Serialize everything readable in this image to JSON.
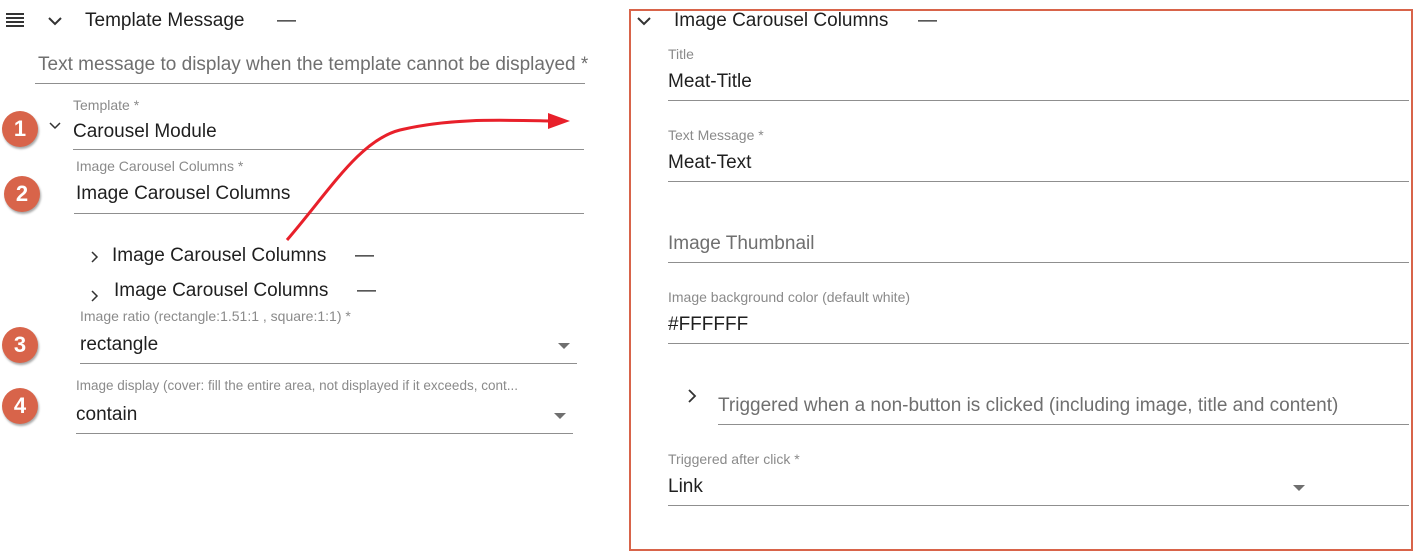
{
  "colors": {
    "badge": "#d8644a",
    "frame": "#d8644a",
    "arrow": "#e8202a"
  },
  "left": {
    "header": {
      "menu_icon": "hamburger-icon",
      "expand_icon": "chevron-down-icon",
      "title": "Template Message",
      "remove_icon": "dash-icon",
      "remove_glyph": "—"
    },
    "alt_text_field": {
      "placeholder": "Text message to display when the template cannot be displayed *"
    },
    "template_field": {
      "badge": "1",
      "label": "Template *",
      "value": "Carousel Module"
    },
    "columns_field": {
      "badge": "2",
      "label": "Image Carousel Columns *",
      "value": "Image Carousel Columns"
    },
    "column_items": [
      {
        "label": "Image Carousel Columns",
        "remove_glyph": "—"
      },
      {
        "label": "Image Carousel Columns",
        "remove_glyph": "—"
      }
    ],
    "ratio_field": {
      "badge": "3",
      "label": "Image ratio (rectangle:1.51:1 , square:1:1) *",
      "value": "rectangle"
    },
    "display_field": {
      "badge": "4",
      "label": "Image display (cover: fill the entire area, not displayed if it exceeds, cont...",
      "value": "contain"
    }
  },
  "right": {
    "header": {
      "title": "Image Carousel Columns",
      "remove_glyph": "—"
    },
    "title_field": {
      "label": "Title",
      "value": "Meat-Title"
    },
    "text_field": {
      "label": "Text Message *",
      "value": "Meat-Text"
    },
    "thumbnail_field": {
      "placeholder": "Image Thumbnail"
    },
    "bg_color_field": {
      "label": "Image background color (default white)",
      "value": "#FFFFFF"
    },
    "non_button_action": {
      "label": "Triggered when a non-button is clicked (including image, title and content)"
    },
    "after_click_field": {
      "label": "Triggered after click *",
      "value": "Link"
    }
  }
}
